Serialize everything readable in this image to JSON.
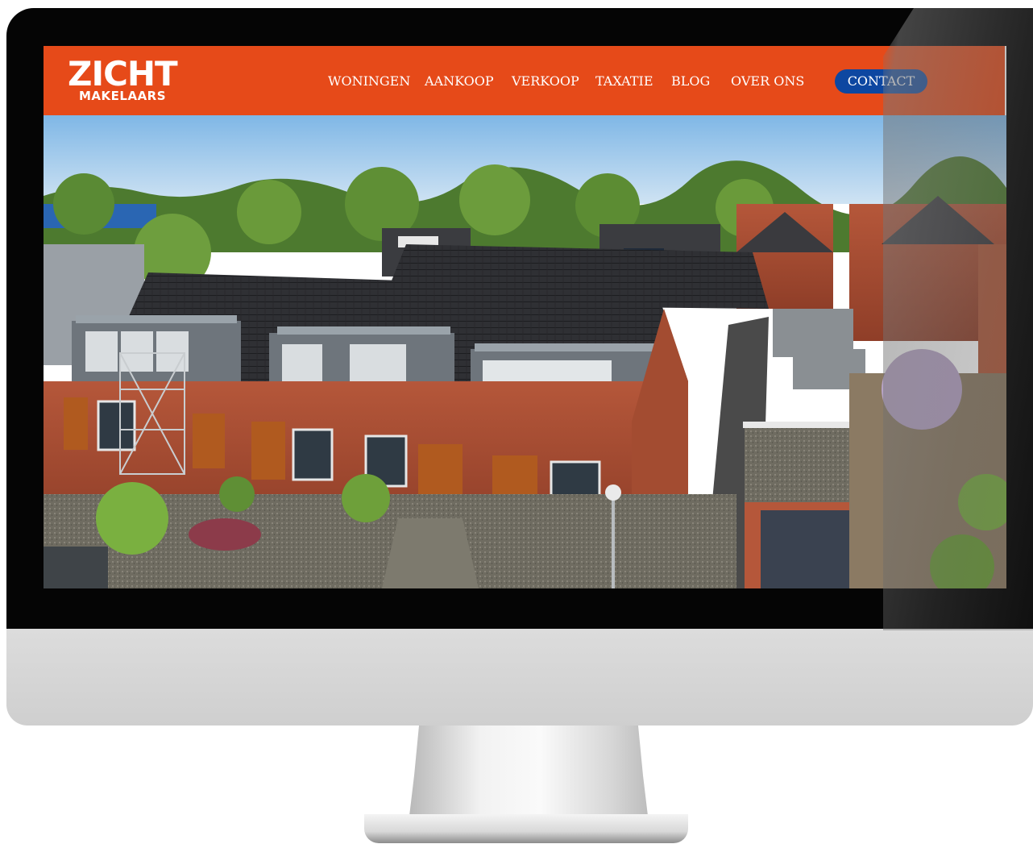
{
  "brand": {
    "name": "ZICHT",
    "tagline": "MAKELAARS",
    "color": "#e64a19"
  },
  "nav": {
    "items": [
      {
        "label": "WONINGEN"
      },
      {
        "label": "AANKOOP"
      },
      {
        "label": "VERKOOP"
      },
      {
        "label": "TAXATIE"
      },
      {
        "label": "BLOG"
      },
      {
        "label": "OVER ONS"
      }
    ],
    "contact_label": "CONTACT",
    "contact_color": "#0d47a1"
  },
  "hero": {
    "icon": "aerial-house-photo"
  }
}
